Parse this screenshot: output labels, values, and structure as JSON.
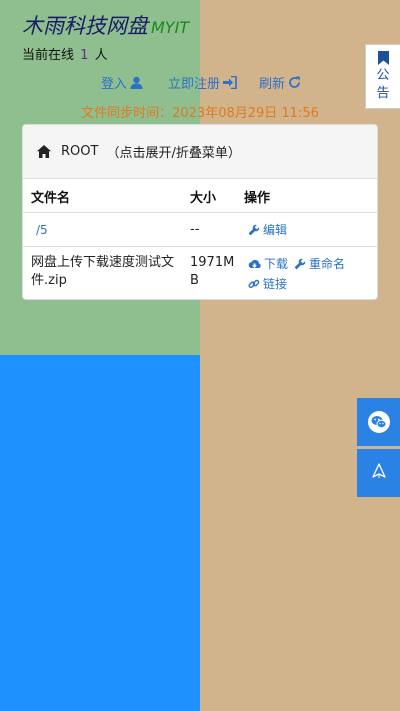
{
  "brand": {
    "name": "木雨科技网盘",
    "sub": "MYIT"
  },
  "online": {
    "prefix": "当前在线",
    "count": "1",
    "suffix": "人"
  },
  "notice": {
    "line1": "公",
    "line2": "告"
  },
  "nav": {
    "login": "登入",
    "register": "立即注册",
    "refresh": "刷新"
  },
  "sync": {
    "text": "文件同步时间：2023年08月29日 11:56"
  },
  "panel": {
    "root": "ROOT",
    "hint": "（点击展开/折叠菜单）"
  },
  "table": {
    "headers": {
      "name": "文件名",
      "size": "大小",
      "action": "操作"
    },
    "rows": [
      {
        "name": "/5",
        "size": "--",
        "actions": {
          "edit": "编辑"
        }
      },
      {
        "name_line1": "网盘上传下载速度测试文",
        "name_line2": "件.zip",
        "size_line1": "1971M",
        "size_line2": "B",
        "actions": {
          "download": "下载",
          "rename": "重命名",
          "link": "链接"
        }
      }
    ]
  },
  "colors": {
    "topLeft": "#8fbf8f",
    "right": "#d2b48c",
    "bottomLeft": "#1e90ff",
    "accent": "#2a72c8",
    "sync": "#e07a20"
  },
  "icons": [
    "user-icon",
    "sign-in-icon",
    "refresh-icon",
    "bookmark-icon",
    "home-icon",
    "wrench-icon",
    "cloud-download-icon",
    "link-icon",
    "wechat-icon",
    "back-to-top-icon"
  ]
}
